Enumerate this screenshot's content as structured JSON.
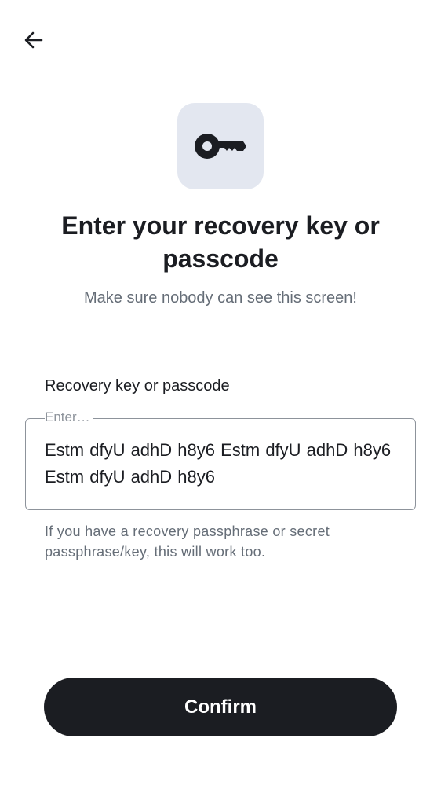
{
  "header": {
    "back_icon": "arrow-left-icon"
  },
  "hero": {
    "icon": "key-icon",
    "badge_color": "#e3e7f0",
    "title": "Enter your recovery key or passcode",
    "subtitle": "Make sure nobody can see this screen!"
  },
  "form": {
    "label": "Recovery key or passcode",
    "placeholder": "Enter…",
    "value": "Estm dfyU adhD h8y6 Estm dfyU adhD h8y6 Estm dfyU adhD h8y6",
    "helper": "If you have a recovery passphrase or secret passphrase/key, this will work too."
  },
  "actions": {
    "confirm_label": "Confirm",
    "button_color": "#1b1d22"
  }
}
